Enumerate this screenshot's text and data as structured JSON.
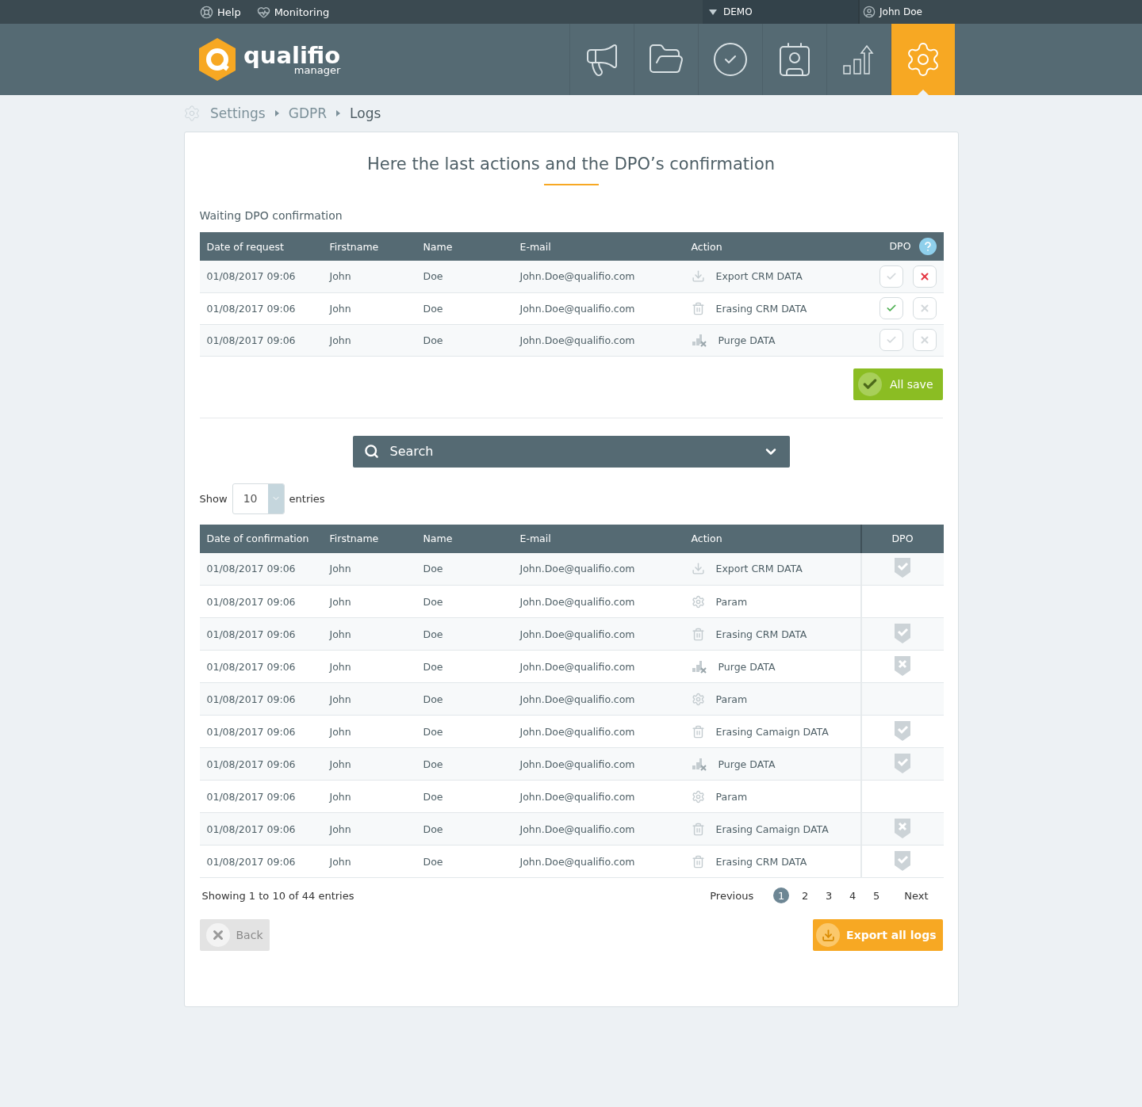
{
  "topbar": {
    "links": [
      {
        "kind": "help",
        "label": "Help"
      },
      {
        "kind": "monitoring",
        "label": "Monitoring"
      }
    ],
    "workspace": "DEMO",
    "user": "John Doe"
  },
  "header": {
    "logo": "qualifio",
    "logo_sub": "manager",
    "nav": [
      {
        "kind": "campaigns",
        "selected": false
      },
      {
        "kind": "folders",
        "selected": false
      },
      {
        "kind": "validation",
        "selected": false
      },
      {
        "kind": "contacts",
        "selected": false
      },
      {
        "kind": "stats",
        "selected": false
      },
      {
        "kind": "settings",
        "selected": true
      }
    ]
  },
  "breadcrumb": [
    "Settings",
    "GDPR",
    "Logs"
  ],
  "title": "Here the last actions and the DPO’s confirmation",
  "pending": {
    "heading": "Waiting DPO confirmation",
    "columns": [
      "Date of request",
      "Firstname",
      "Name",
      "E-mail",
      "Action",
      "DPO"
    ],
    "rows": [
      {
        "date": "01/08/2017 09:06",
        "firstname": "John",
        "name": "Doe",
        "email": "John.Doe@qualifio.com",
        "kind": "export",
        "action": "Export CRM DATA",
        "approve_selected": false,
        "reject_selected": true
      },
      {
        "date": "01/08/2017 09:06",
        "firstname": "John",
        "name": "Doe",
        "email": "John.Doe@qualifio.com",
        "kind": "erase",
        "action": "Erasing CRM DATA",
        "approve_selected": true,
        "reject_selected": false
      },
      {
        "date": "01/08/2017 09:06",
        "firstname": "John",
        "name": "Doe",
        "email": "John.Doe@qualifio.com",
        "kind": "purge",
        "action": "Purge DATA",
        "approve_selected": false,
        "reject_selected": false
      }
    ],
    "save_button": "All save"
  },
  "search": {
    "label": "Search",
    "expanded": false
  },
  "length": {
    "label": "Show",
    "value": "10",
    "suffix": "entries"
  },
  "logs": {
    "columns": [
      "Date of confirmation",
      "Firstname",
      "Name",
      "E-mail",
      "Action",
      "DPO"
    ],
    "rows": [
      {
        "date": "01/08/2017 09:06",
        "firstname": "John",
        "name": "Doe",
        "email": "John.Doe@qualifio.com",
        "kind": "export",
        "action": "Export CRM DATA",
        "approved": true,
        "rejected": false
      },
      {
        "date": "01/08/2017 09:06",
        "firstname": "John",
        "name": "Doe",
        "email": "John.Doe@qualifio.com",
        "kind": "param",
        "action": "Param",
        "approved": false,
        "rejected": false
      },
      {
        "date": "01/08/2017 09:06",
        "firstname": "John",
        "name": "Doe",
        "email": "John.Doe@qualifio.com",
        "kind": "erase",
        "action": "Erasing CRM DATA",
        "approved": true,
        "rejected": false
      },
      {
        "date": "01/08/2017 09:06",
        "firstname": "John",
        "name": "Doe",
        "email": "John.Doe@qualifio.com",
        "kind": "purge",
        "action": "Purge DATA",
        "approved": false,
        "rejected": true
      },
      {
        "date": "01/08/2017 09:06",
        "firstname": "John",
        "name": "Doe",
        "email": "John.Doe@qualifio.com",
        "kind": "param",
        "action": "Param",
        "approved": false,
        "rejected": false
      },
      {
        "date": "01/08/2017 09:06",
        "firstname": "John",
        "name": "Doe",
        "email": "John.Doe@qualifio.com",
        "kind": "erase",
        "action": "Erasing Camaign DATA",
        "approved": true,
        "rejected": false
      },
      {
        "date": "01/08/2017 09:06",
        "firstname": "John",
        "name": "Doe",
        "email": "John.Doe@qualifio.com",
        "kind": "purge",
        "action": "Purge DATA",
        "approved": true,
        "rejected": false
      },
      {
        "date": "01/08/2017 09:06",
        "firstname": "John",
        "name": "Doe",
        "email": "John.Doe@qualifio.com",
        "kind": "param",
        "action": "Param",
        "approved": false,
        "rejected": false
      },
      {
        "date": "01/08/2017 09:06",
        "firstname": "John",
        "name": "Doe",
        "email": "John.Doe@qualifio.com",
        "kind": "erase",
        "action": "Erasing Camaign DATA",
        "approved": false,
        "rejected": true
      },
      {
        "date": "01/08/2017 09:06",
        "firstname": "John",
        "name": "Doe",
        "email": "John.Doe@qualifio.com",
        "kind": "erase",
        "action": "Erasing CRM DATA",
        "approved": true,
        "rejected": false
      }
    ]
  },
  "info": "Showing 1 to 10 of 44 entries",
  "pagination": {
    "previous": "Previous",
    "next": "Next",
    "pages": [
      {
        "label": "1",
        "selected": true
      },
      {
        "label": "2",
        "selected": false
      },
      {
        "label": "3",
        "selected": false
      },
      {
        "label": "4",
        "selected": false
      },
      {
        "label": "5",
        "selected": false
      }
    ]
  },
  "back_button": "Back",
  "export_button": "Export all logs"
}
